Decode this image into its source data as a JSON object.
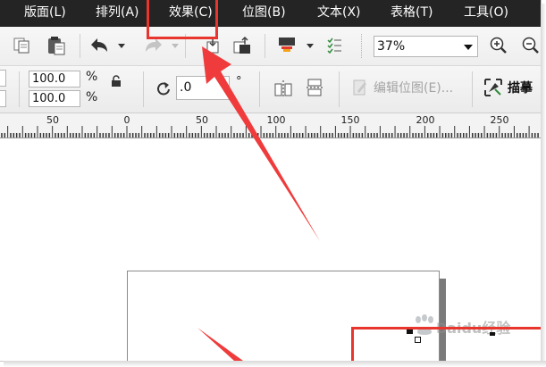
{
  "menubar": {
    "items": [
      {
        "label": "版面(L)"
      },
      {
        "label": "排列(A)"
      },
      {
        "label": "效果(C)"
      },
      {
        "label": "位图(B)"
      },
      {
        "label": "文本(X)"
      },
      {
        "label": "表格(T)"
      },
      {
        "label": "工具(O)"
      }
    ]
  },
  "toolbar": {
    "zoom": "37%"
  },
  "property_bar": {
    "scale_x": "100.0",
    "scale_y": "100.0",
    "percent_x": "%",
    "percent_y": "%",
    "rotation": ".0",
    "degree": "°",
    "edit_bitmap": "编辑位图(E)...",
    "trace": "描摹"
  },
  "ruler": {
    "labels": [
      "50",
      "0",
      "50",
      "100",
      "150",
      "200",
      "250"
    ]
  },
  "watermark": "Baidu经验",
  "colors": {
    "menubar_bg": "#242424",
    "highlight": "#e8352d",
    "arrow": "#ef3b3b"
  }
}
